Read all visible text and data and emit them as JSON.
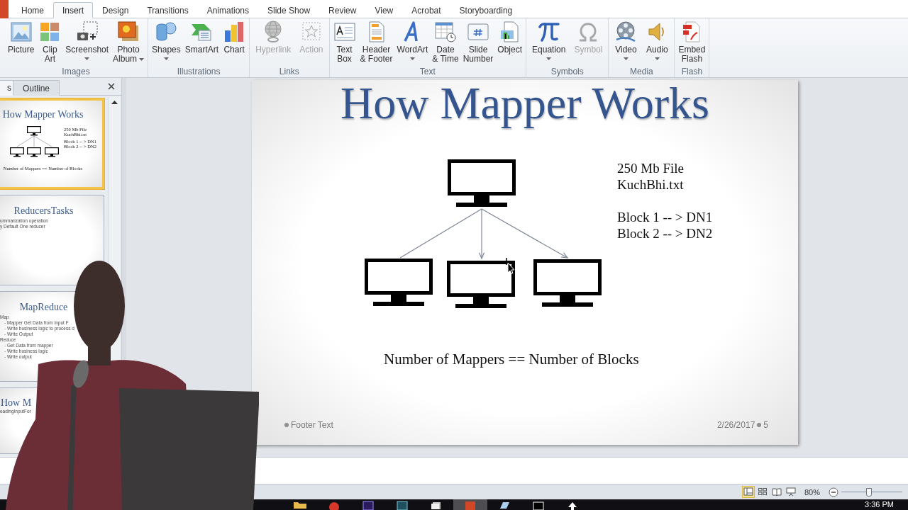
{
  "tabs": [
    {
      "label": "Home",
      "selected": false
    },
    {
      "label": "Insert",
      "selected": true
    },
    {
      "label": "Design",
      "selected": false
    },
    {
      "label": "Transitions",
      "selected": false
    },
    {
      "label": "Animations",
      "selected": false
    },
    {
      "label": "Slide Show",
      "selected": false
    },
    {
      "label": "Review",
      "selected": false
    },
    {
      "label": "View",
      "selected": false
    },
    {
      "label": "Acrobat",
      "selected": false
    },
    {
      "label": "Storyboarding",
      "selected": false
    }
  ],
  "ribbon_groups": [
    {
      "label": "Images",
      "buttons": [
        {
          "kind": "picture",
          "lines": [
            "Picture"
          ],
          "dropdown": false,
          "disabled": false
        },
        {
          "kind": "clipart",
          "lines": [
            "Clip",
            "Art"
          ],
          "dropdown": false,
          "disabled": false
        },
        {
          "kind": "screenshot",
          "lines": [
            "Screenshot"
          ],
          "dropdown": true,
          "disabled": false
        },
        {
          "kind": "album",
          "lines": [
            "Photo",
            "Album"
          ],
          "dropdown": true,
          "disabled": false
        }
      ]
    },
    {
      "label": "Illustrations",
      "buttons": [
        {
          "kind": "shapes",
          "lines": [
            "Shapes"
          ],
          "dropdown": true,
          "disabled": false
        },
        {
          "kind": "smartart",
          "lines": [
            "SmartArt"
          ],
          "dropdown": false,
          "disabled": false
        },
        {
          "kind": "chart",
          "lines": [
            "Chart"
          ],
          "dropdown": false,
          "disabled": false
        }
      ]
    },
    {
      "label": "Links",
      "buttons": [
        {
          "kind": "hyperlink",
          "lines": [
            "Hyperlink"
          ],
          "dropdown": false,
          "disabled": true
        },
        {
          "kind": "action",
          "lines": [
            "Action"
          ],
          "dropdown": false,
          "disabled": true
        }
      ]
    },
    {
      "label": "Text",
      "buttons": [
        {
          "kind": "textbox",
          "lines": [
            "Text",
            "Box"
          ],
          "dropdown": false,
          "disabled": false
        },
        {
          "kind": "header",
          "lines": [
            "Header",
            "& Footer"
          ],
          "dropdown": false,
          "disabled": false
        },
        {
          "kind": "wordart",
          "lines": [
            "WordArt"
          ],
          "dropdown": true,
          "disabled": false
        },
        {
          "kind": "datetime",
          "lines": [
            "Date",
            "& Time"
          ],
          "dropdown": false,
          "disabled": false
        },
        {
          "kind": "slidenumber",
          "lines": [
            "Slide",
            "Number"
          ],
          "dropdown": false,
          "disabled": false
        },
        {
          "kind": "object",
          "lines": [
            "Object"
          ],
          "dropdown": false,
          "disabled": false
        }
      ]
    },
    {
      "label": "Symbols",
      "buttons": [
        {
          "kind": "equation",
          "lines": [
            "Equation"
          ],
          "dropdown": true,
          "disabled": false
        },
        {
          "kind": "symbol",
          "lines": [
            "Symbol"
          ],
          "dropdown": false,
          "disabled": true
        }
      ]
    },
    {
      "label": "Media",
      "buttons": [
        {
          "kind": "video",
          "lines": [
            "Video"
          ],
          "dropdown": true,
          "disabled": false
        },
        {
          "kind": "audio",
          "lines": [
            "Audio"
          ],
          "dropdown": true,
          "disabled": false
        }
      ]
    },
    {
      "label": "Flash",
      "buttons": [
        {
          "kind": "flash",
          "lines": [
            "Embed",
            "Flash"
          ],
          "dropdown": false,
          "disabled": false
        }
      ]
    }
  ],
  "slides_panel": {
    "tabs": [
      {
        "label": "s",
        "selected": true
      },
      {
        "label": "Outline",
        "selected": false
      }
    ],
    "thumbnails": [
      {
        "kind": "diagram",
        "selected": true,
        "title": "How Mapper Works",
        "notes": [
          "250 Mb File",
          "KuchBhi.txt",
          "Block 1 -- > DN1",
          "Block 2 -- > DN2"
        ],
        "caption": "Number of Mappers == Number of Blocks"
      },
      {
        "kind": "bullets",
        "selected": false,
        "title": "ReducersTasks",
        "items": [
          {
            "text": "ummarization  operation"
          },
          {
            "text": "y Default  One  reducer"
          }
        ]
      },
      {
        "kind": "bullets",
        "selected": false,
        "title": "MapReduce",
        "items": [
          {
            "text": "Map",
            "children": [
              {
                "text": "- Mapper  Get Data from Input F"
              },
              {
                "text": "- Write business logic to process d"
              },
              {
                "text": "- Write Output"
              }
            ]
          },
          {
            "text": "Reduce",
            "children": [
              {
                "text": "- Get Data from mapper"
              },
              {
                "text": "- Write business logic"
              },
              {
                "text": "- Write output"
              }
            ]
          }
        ]
      },
      {
        "kind": "partial",
        "selected": false,
        "title": "How M",
        "items": [
          {
            "text": "eadingInputFor"
          }
        ]
      }
    ]
  },
  "slide": {
    "title": "How Mapper Works",
    "diagram": {
      "connectors": [
        {
          "arrow": false
        },
        {
          "arrow": true
        },
        {
          "arrow": true
        }
      ]
    },
    "file_info": [
      "250 Mb File",
      "KuchBhi.txt"
    ],
    "blocks": [
      "Block 1 -- > DN1",
      "Block 2 -- > DN2"
    ],
    "caption": "Number of Mappers == Number of Blocks",
    "footer": "Footer Text",
    "date": "2/26/2017",
    "slide_number": "5"
  },
  "status_bar": {
    "views": [
      {
        "kind": "normal",
        "selected": true
      },
      {
        "kind": "sorter",
        "selected": false
      },
      {
        "kind": "reading",
        "selected": false
      },
      {
        "kind": "slideshow",
        "selected": false
      }
    ],
    "zoom": {
      "label": "80%",
      "level": 0.45
    }
  },
  "taskbar": {
    "apps": [
      {
        "kind": "folder",
        "selected": false
      },
      {
        "kind": "round",
        "selected": false
      },
      {
        "kind": "tile",
        "selected": false
      },
      {
        "kind": "tealtile",
        "selected": false
      },
      {
        "kind": "pages",
        "selected": false
      },
      {
        "kind": "slides",
        "selected": true
      },
      {
        "kind": "device",
        "selected": false
      },
      {
        "kind": "window",
        "selected": false
      },
      {
        "kind": "upload",
        "selected": false
      }
    ],
    "clock": "3:36 PM"
  }
}
